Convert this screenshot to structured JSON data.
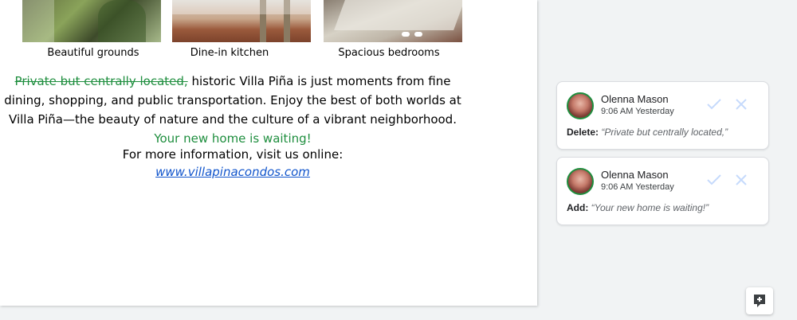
{
  "document": {
    "images": [
      {
        "caption": "Beautiful grounds"
      },
      {
        "caption": "Dine-in kitchen"
      },
      {
        "caption": "Spacious bedrooms"
      }
    ],
    "paragraph": {
      "deleted_text": "Private but centrally located,",
      "text": " historic Villa Piña is just moments from fine dining, shopping, and public transportation. Enjoy the best of both worlds at Villa Piña—the beauty of nature and the culture of a vibrant neighborhood. ",
      "added_text": "Your new home is waiting!"
    },
    "info_line": "For more information, visit us online:",
    "link_text": "www.villapinacondos.com"
  },
  "suggestions": [
    {
      "author": "Olenna Mason",
      "time": "9:06 AM Yesterday",
      "kind": "Delete:",
      "quote": "“Private but centrally located,”"
    },
    {
      "author": "Olenna Mason",
      "time": "9:06 AM Yesterday",
      "kind": "Add:",
      "quote": "“Your new home is waiting!”"
    }
  ],
  "colors": {
    "suggestion_green": "#1e8e3e",
    "link_blue": "#1155cc",
    "icon_inactive": "#c6dafc"
  },
  "icons": {
    "accept": "check-icon",
    "reject": "close-icon",
    "add_comment": "add-comment-icon"
  }
}
